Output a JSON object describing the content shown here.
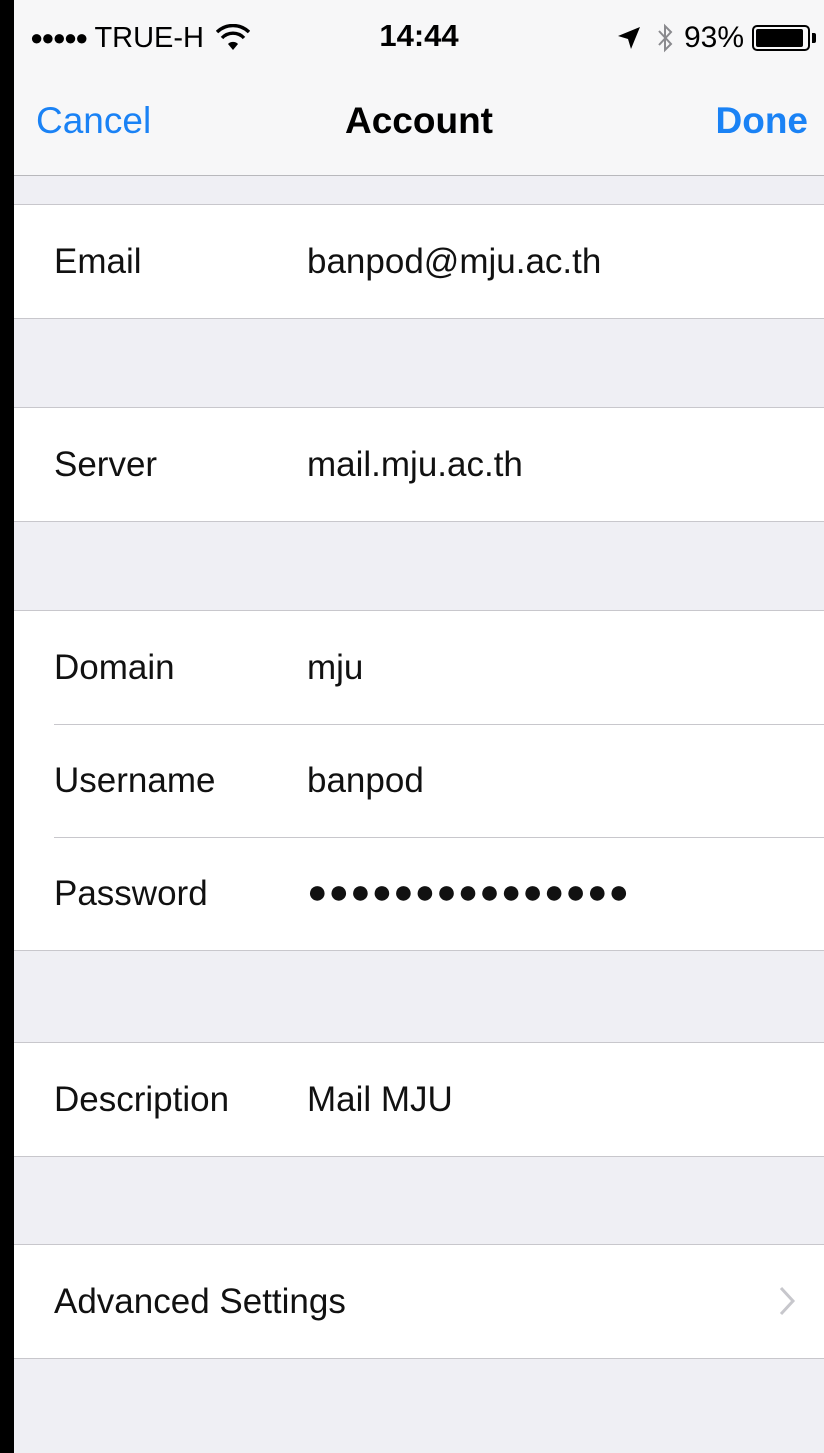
{
  "status_bar": {
    "signal": "●●●●●",
    "carrier": "TRUE-H",
    "time": "14:44",
    "battery_percent_text": "93%",
    "battery_level": 0.93,
    "icons": [
      "wifi-icon",
      "location-arrow-icon",
      "bluetooth-icon",
      "battery-icon"
    ]
  },
  "nav": {
    "cancel_label": "Cancel",
    "title": "Account",
    "done_label": "Done",
    "accent_color": "#1a82f5"
  },
  "fields": {
    "email": {
      "label": "Email",
      "value": "banpod@mju.ac.th"
    },
    "server": {
      "label": "Server",
      "value": "mail.mju.ac.th"
    },
    "domain": {
      "label": "Domain",
      "value": "mju"
    },
    "username": {
      "label": "Username",
      "value": "banpod"
    },
    "password": {
      "label": "Password",
      "value": "●●●●●●●●●●●●●●●"
    },
    "description": {
      "label": "Description",
      "value": "Mail MJU"
    }
  },
  "advanced": {
    "label": "Advanced Settings",
    "icon": "chevron-right-icon"
  }
}
